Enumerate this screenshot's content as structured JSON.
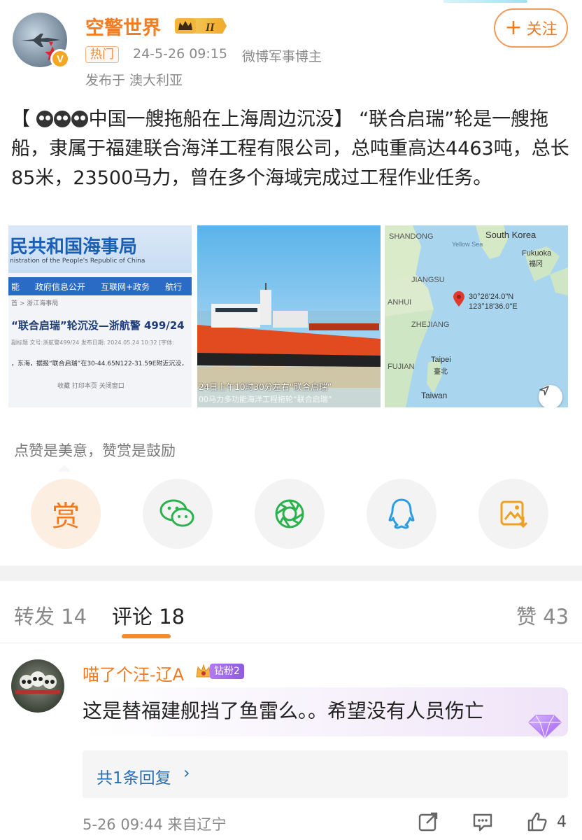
{
  "author": {
    "name": "空警世界",
    "level_badge": "II",
    "hot_tag": "热门",
    "time": "24-5-26 09:15",
    "source": "微博军事博主",
    "location": "发布于 澳大利亚",
    "follow_label": "关注"
  },
  "post": {
    "bracket_open": "【",
    "headline": "中国一艘拖船在上海周边沉没",
    "bracket_close": "】",
    "body": "“联合启瑞”轮是一艘拖船，隶属于福建联合海洋工程有限公司，总吨重高达4463吨，总长85米，23500马力，曾在多个海域完成过工程作业任务。"
  },
  "images": {
    "img1": {
      "title": "民共和国海事局",
      "subtitle": "nistration of the People's Republic of China",
      "nav": [
        "能",
        "政府信息公开",
        "互联网+政务",
        "航行"
      ],
      "crumb": "首 > 浙江海事局",
      "headline": "“联合启瑞”轮沉没—浙航警 499/24",
      "info": "副标题  文号:浙航警499/24  发布日期: 2024.05.24 10:32  [字体:",
      "body": "，东海，据报“联合启瑞”在30-44.65N122-31.59E附近沉没，",
      "tools": "收藏    打印本页    关闭窗口"
    },
    "img2": {
      "caption1": "24日上午10时30分左右“联合启瑞”",
      "caption2": "00马力多功能海洋工程拖轮“联合启瑞”"
    },
    "img3": {
      "labels": {
        "shandong": "SHANDONG",
        "yellow_sea": "Yellow Sea",
        "south_korea": "South Korea",
        "fukuoka": "Fukuoka",
        "fukuoka_cn": "福冈",
        "jiangsu": "JIANGSU",
        "anhui": "ANHUI",
        "zhejiang": "ZHEJIANG",
        "fujian": "FUJIAN",
        "taipei": "Taipei",
        "taipei_cn": "臺北",
        "taiwan": "Taiwan",
        "coord1": "30°26'24.0\"N",
        "coord2": "123°18'36.0\"E"
      }
    }
  },
  "reward": {
    "prompt": "点赞是美意，赞赏是鼓励",
    "reward_label": "赏"
  },
  "tabs": {
    "repost": "转发 14",
    "comments": "评论 18",
    "likes": "赞 43"
  },
  "comment": {
    "user": "喵了个汪-辽A",
    "fan_badge": "钻粉2",
    "text": "这是替福建舰挡了鱼雷么。。希望没有人员伤亡",
    "replies_label": "共1条回复",
    "time_loc": "5-26 09:44  来自辽宁",
    "like_count": "4"
  },
  "colors": {
    "accent": "#f07a22",
    "link": "#2b6fb3",
    "fan_purple": "#9a66e6"
  }
}
